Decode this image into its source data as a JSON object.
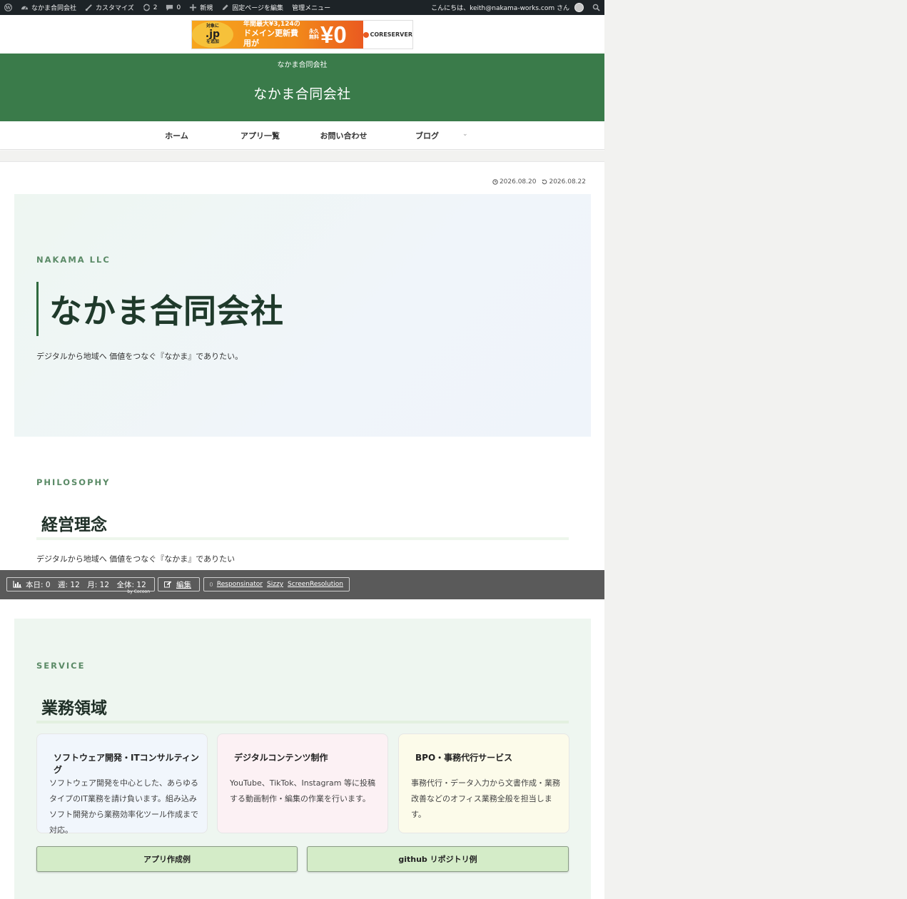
{
  "adminbar": {
    "site_name": "なかま合同会社",
    "customize": "カスタマイズ",
    "updates_count": "2",
    "comments_count": "0",
    "new": "新規",
    "edit_page": "固定ページを編集",
    "admin_menu": "管理メニュー",
    "greeting": "こんにちは、keith@nakama-works.com さん"
  },
  "ad": {
    "circle_top": "対象に",
    "circle_big": ".jp",
    "circle_bottom": "を追加",
    "line1": "年間最大¥3,124の",
    "line2": "ドメイン更新費用が",
    "free": "永久無料",
    "yen_zero": "¥0",
    "brand": "CORESERVER"
  },
  "header": {
    "tagline": "なかま合同会社",
    "title": "なかま合同会社"
  },
  "nav": {
    "items": [
      "ホーム",
      "アプリ一覧",
      "お問い合わせ",
      "ブログ"
    ],
    "caret": "⌄"
  },
  "post": {
    "published": "2026.08.20",
    "updated": "2026.08.22"
  },
  "hero": {
    "eyebrow": "NAKAMA LLC",
    "title": "なかま合同会社",
    "description": "デジタルから地域へ 価値をつなぐ『なかま』でありたい。"
  },
  "philosophy": {
    "eyebrow": "PHILOSOPHY",
    "title": "経営理念",
    "description": "デジタルから地域へ 価値をつなぐ『なかま』でありたい"
  },
  "debugbar": {
    "stats": "本日: 0　週: 12　月: 12　全体: 12",
    "by": "by Cocoon",
    "edit": "編集",
    "links": [
      "Responsinator",
      "Sizzy",
      "ScreenResolution"
    ]
  },
  "service": {
    "eyebrow": "SERVICE",
    "title": "業務領域",
    "cards": [
      {
        "title": "ソフトウェア開発・ITコンサルティング",
        "desc": "ソフトウェア開発を中心とした、あらゆるタイプのIT業務を請け負います。組み込みソフト開発から業務効率化ツール作成まで対応。",
        "bg": "#f1f6fc"
      },
      {
        "title": "デジタルコンテンツ制作",
        "desc": "YouTube、TikTok、Instagram 等に投稿する動画制作・編集の作業を行います。",
        "bg": "#fcf1f4"
      },
      {
        "title": "BPO・事務代行サービス",
        "desc": "事務代行・データ入力から文書作成・業務改善などのオフィス業務全般を担当します。",
        "bg": "#fcfbea"
      }
    ],
    "buttons": [
      "アプリ作成例",
      "github リポジトリ例"
    ]
  },
  "colors": {
    "header_green": "#3a7b4a",
    "accent_green": "#5a8a66",
    "button_green": "#d4ecc8"
  }
}
